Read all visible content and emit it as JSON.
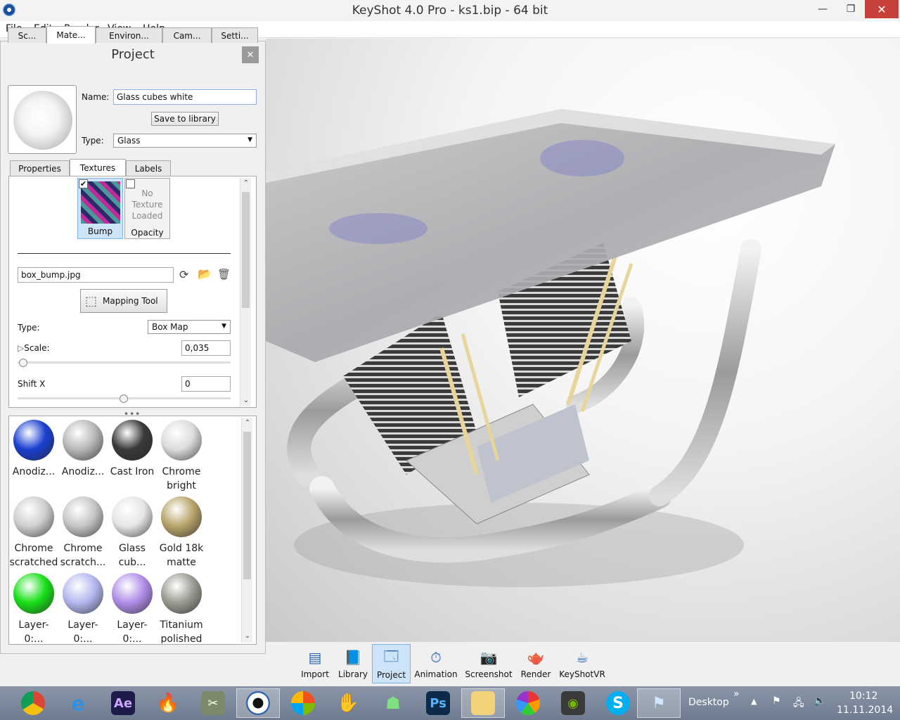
{
  "window": {
    "title": "KeyShot 4.0 Pro  - ks1.bip  - 64 bit",
    "minimize": "—",
    "maximize": "❐",
    "close": "✕"
  },
  "menu": [
    "File",
    "Edit",
    "Render",
    "View",
    "Help"
  ],
  "project_panel": {
    "title": "Project",
    "close": "✕",
    "tabs": [
      "Sc...",
      "Mate...",
      "Environ...",
      "Cam...",
      "Setti..."
    ],
    "active_tab": "Mate...",
    "name_label": "Name:",
    "name_value": "Glass cubes white",
    "save_button": "Save to library",
    "type_label": "Type:",
    "type_value": "Glass",
    "subtabs": [
      "Properties",
      "Textures",
      "Labels"
    ],
    "active_subtab": "Textures",
    "texture_slots": {
      "bump_label": "Bump",
      "opacity_label": "Opacity",
      "opacity_empty_1": "No",
      "opacity_empty_2": "Texture",
      "opacity_empty_3": "Loaded"
    },
    "texture_file": "box_bump.jpg",
    "mapping_tool": "Mapping Tool",
    "map_type_label": "Type:",
    "map_type_value": "Box Map",
    "scale_label": "Scale:",
    "scale_value": "0,035",
    "shiftx_label": "Shift X",
    "shiftx_value": "0"
  },
  "materials": [
    {
      "l1": "Anodiz...",
      "l2": "",
      "color": "#1a3fd1"
    },
    {
      "l1": "Anodiz...",
      "l2": "",
      "color": "#b8b8b8"
    },
    {
      "l1": "Cast Iron",
      "l2": "",
      "color": "#3a3a3a"
    },
    {
      "l1": "Chrome",
      "l2": "bright",
      "color": "#dcdcdc"
    },
    {
      "l1": "Chrome",
      "l2": "scratched",
      "color": "#cfcfcf"
    },
    {
      "l1": "Chrome",
      "l2": "scratch...",
      "color": "#c6c6c6"
    },
    {
      "l1": "Glass",
      "l2": "cub...",
      "color": "#e6e6e6"
    },
    {
      "l1": "Gold 18k",
      "l2": "matte",
      "color": "#b8a46a"
    },
    {
      "l1": "Layer-0:...",
      "l2": "",
      "color": "#18e018"
    },
    {
      "l1": "Layer-0:...",
      "l2": "",
      "color": "#b4b8ef"
    },
    {
      "l1": "Layer-0:...",
      "l2": "",
      "color": "#b08ee8"
    },
    {
      "l1": "Titanium",
      "l2": "polished",
      "color": "#9c9c94"
    }
  ],
  "toolbar": [
    "Import",
    "Library",
    "Project",
    "Animation",
    "Screenshot",
    "Render",
    "KeyShotVR"
  ],
  "active_tool": "Project",
  "taskbar": {
    "desktop": "Desktop",
    "chevron": "»",
    "time": "10:12",
    "date": "11.11.2014"
  }
}
